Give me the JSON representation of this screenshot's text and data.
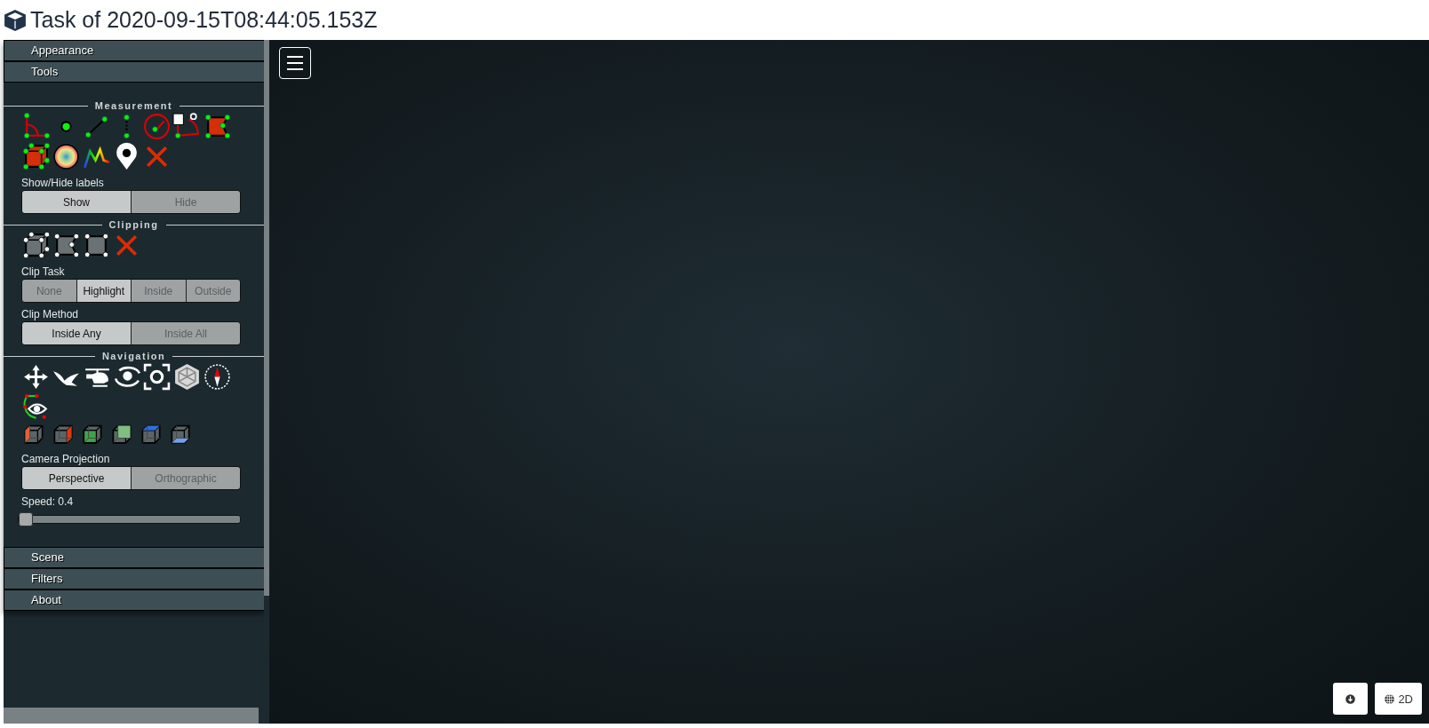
{
  "title": "Task of 2020-09-15T08:44:05.153Z",
  "sidebar": {
    "sections": [
      {
        "label": "Appearance"
      },
      {
        "label": "Tools",
        "tools": {
          "measurement": {
            "heading": "Measurement",
            "labels_caption": "Show/Hide labels",
            "labels_toggle": [
              {
                "label": "Show",
                "selected": true
              },
              {
                "label": "Hide",
                "selected": false
              }
            ]
          },
          "clipping": {
            "heading": "Clipping",
            "clip_task_caption": "Clip Task",
            "clip_task": [
              {
                "label": "None",
                "selected": false
              },
              {
                "label": "Highlight",
                "selected": true
              },
              {
                "label": "Inside",
                "selected": false
              },
              {
                "label": "Outside",
                "selected": false
              }
            ],
            "clip_method_caption": "Clip Method",
            "clip_method": [
              {
                "label": "Inside Any",
                "selected": true
              },
              {
                "label": "Inside All",
                "selected": false
              }
            ]
          },
          "navigation": {
            "heading": "Navigation",
            "projection_caption": "Camera Projection",
            "projection": [
              {
                "label": "Perspective",
                "selected": true
              },
              {
                "label": "Orthographic",
                "selected": false
              }
            ],
            "speed_label": "Speed: 0.4",
            "speed": {
              "level": 0
            }
          }
        }
      },
      {
        "label": "Scene"
      },
      {
        "label": "Filters"
      },
      {
        "label": "About"
      }
    ]
  },
  "viewer": {
    "view_button": {
      "label": "2D"
    }
  }
}
